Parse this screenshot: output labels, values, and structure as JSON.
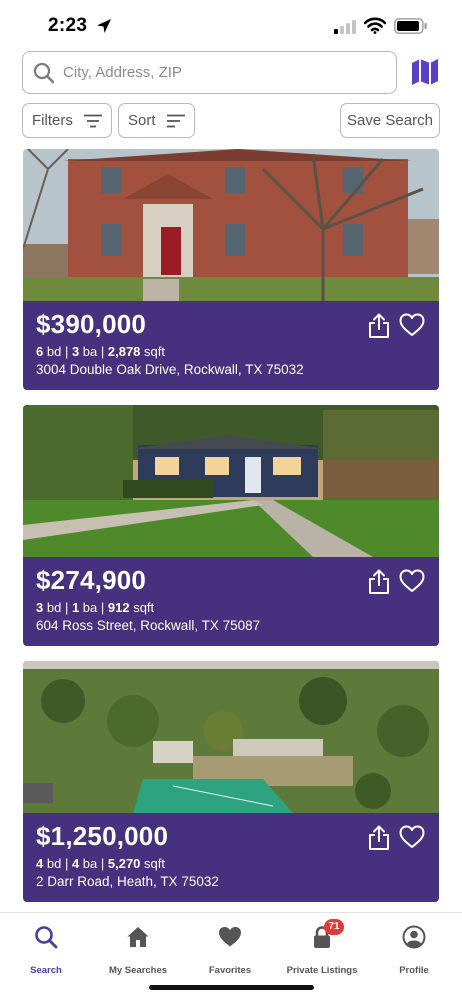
{
  "status_bar": {
    "time": "2:23"
  },
  "search": {
    "placeholder": "City, Address, ZIP"
  },
  "filters": {
    "filters_label": "Filters",
    "sort_label": "Sort",
    "save_search_label": "Save Search"
  },
  "listings": [
    {
      "price": "$390,000",
      "beds": "6",
      "beds_unit": "bd",
      "baths": "3",
      "baths_unit": "ba",
      "sqft": "2,878",
      "sqft_unit": "sqft",
      "address": "3004 Double Oak Drive, Rockwall, TX 75032"
    },
    {
      "price": "$274,900",
      "beds": "3",
      "beds_unit": "bd",
      "baths": "1",
      "baths_unit": "ba",
      "sqft": "912",
      "sqft_unit": "sqft",
      "address": "604 Ross Street, Rockwall, TX 75087"
    },
    {
      "price": "$1,250,000",
      "beds": "4",
      "beds_unit": "bd",
      "baths": "4",
      "baths_unit": "ba",
      "sqft": "5,270",
      "sqft_unit": "sqft",
      "address": "2 Darr Road, Heath, TX 75032"
    }
  ],
  "tabs": [
    {
      "label": "Search",
      "icon": "search-icon",
      "active": true
    },
    {
      "label": "My Searches",
      "icon": "house-icon"
    },
    {
      "label": "Favorites",
      "icon": "heart-icon"
    },
    {
      "label": "Private Listings",
      "icon": "lock-icon",
      "badge": "71"
    },
    {
      "label": "Profile",
      "icon": "person-icon"
    }
  ],
  "colors": {
    "brand": "#46317f",
    "accent": "#4a3ca0",
    "badge": "#e53935"
  }
}
